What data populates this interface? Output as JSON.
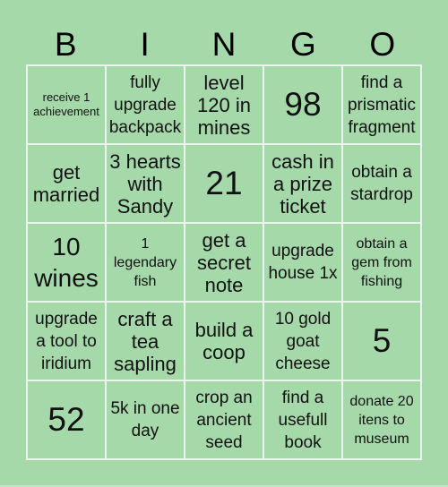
{
  "header": {
    "letters": [
      "B",
      "I",
      "N",
      "G",
      "O"
    ]
  },
  "board": {
    "cells": [
      [
        "receive 1 achievement",
        "fully upgrade backpack",
        "level 120 in mines",
        "98",
        "find a prismatic fragment"
      ],
      [
        "get married",
        "3 hearts with Sandy",
        "21",
        "cash in a prize ticket",
        "obtain a stardrop"
      ],
      [
        "10 wines",
        "1 legendary fish",
        "get a secret note",
        "upgrade house 1x",
        "obtain a gem from fishing"
      ],
      [
        "upgrade a tool to iridium",
        "craft a tea sapling",
        "build a coop",
        "10 gold goat cheese",
        "5"
      ],
      [
        "52",
        "5k in one day",
        "crop an ancient seed",
        "find a usefull book",
        "donate 20 itens to museum"
      ]
    ]
  },
  "colors": {
    "background": "#a5d9aa",
    "grid_lines": "#e8f5e9",
    "text": "#111111"
  }
}
